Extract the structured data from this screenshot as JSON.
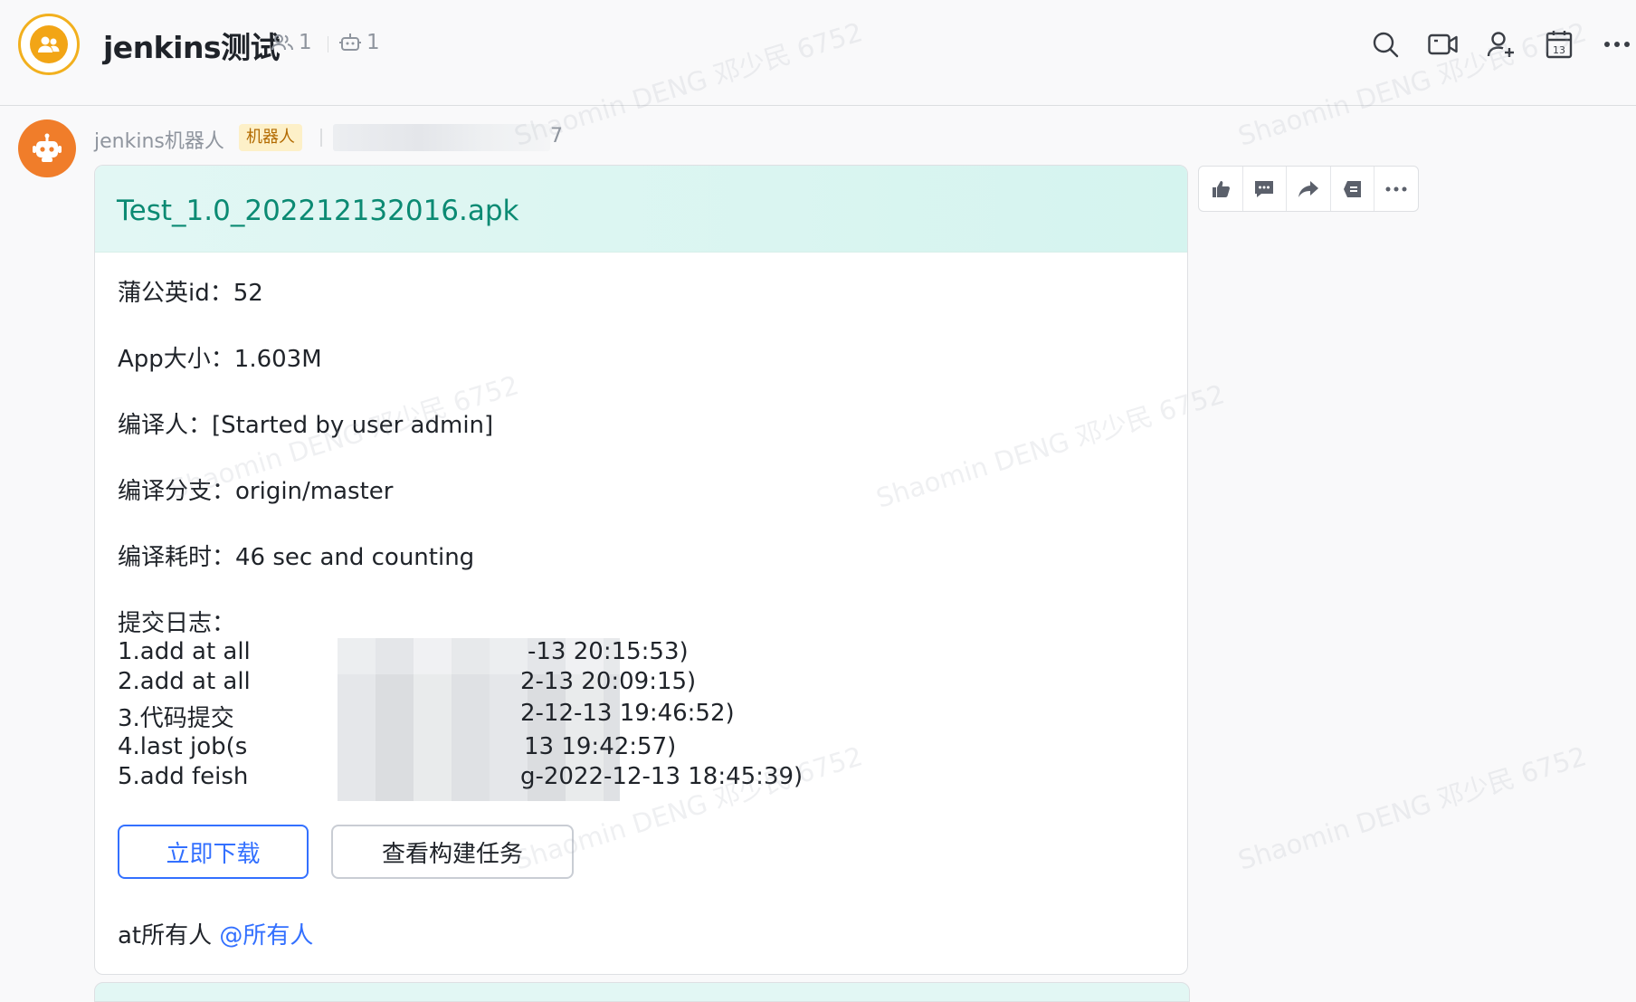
{
  "header": {
    "chat_title": "jenkins测试",
    "member_count": "1",
    "bot_count": "1"
  },
  "message": {
    "sender_name": "jenkins机器人",
    "bot_tag": "机器人",
    "sender_id_tail": "7",
    "card": {
      "title": "Test_1.0_202212132016.apk",
      "lines": [
        "蒲公英id：52",
        "App大小：1.603M",
        "编译人：[Started by user admin]",
        "编译分支：origin/master",
        "编译耗时：46 sec and counting"
      ],
      "commit_log_label": "提交日志：",
      "commits": [
        {
          "head": "1.add at all",
          "tail": "-13 20:15:53)"
        },
        {
          "head": "2.add at all",
          "tail": "2-13 20:09:15)"
        },
        {
          "head": "3.代码提交",
          "tail": "2-12-13 19:46:52)"
        },
        {
          "head": "4.last job(s",
          "tail": "13 19:42:57)"
        },
        {
          "head": "5.add feish",
          "tail": "g-2022-12-13 18:45:39)"
        }
      ],
      "download_button": "立即下载",
      "view_build_button": "查看构建任务",
      "at_text": "at所有人 ",
      "at_mention": "@所有人"
    }
  },
  "watermark": "Shaomin DENG 邓少民 6752",
  "colors": {
    "accent": "#3370ff",
    "card_title": "#0b8a73",
    "card_header": "#d5f4ef",
    "bot_avatar": "#f07d2a",
    "group_avatar": "#f2a516"
  }
}
